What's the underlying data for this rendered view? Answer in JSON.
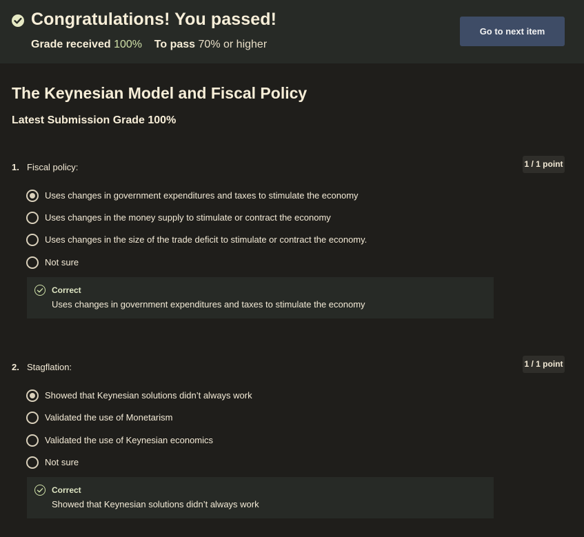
{
  "banner": {
    "title": "Congratulations! You passed!",
    "grade_received_label": "Grade received",
    "grade_received_value": "100%",
    "to_pass_label": "To pass",
    "to_pass_value": "70%",
    "to_pass_suffix": "or higher",
    "next_button_label": "Go to next item",
    "icon": "check-circle-icon",
    "colors": {
      "banner_bg": "#272a26",
      "button_bg": "#3e4c66",
      "correct_green": "#cfe0a8"
    }
  },
  "page": {
    "title": "The Keynesian Model and Fiscal Policy",
    "latest_grade": "Latest Submission Grade 100%"
  },
  "questions": [
    {
      "number": "1.",
      "text": "Fiscal policy:",
      "points": "1 / 1 point",
      "options": [
        {
          "label": "Uses changes in government expenditures and taxes to stimulate the economy",
          "selected": true
        },
        {
          "label": "Uses changes in the money supply to stimulate or contract the economy",
          "selected": false
        },
        {
          "label": "Uses changes in the size of the trade deficit to stimulate or contract the economy.",
          "selected": false
        },
        {
          "label": "Not sure",
          "selected": false
        }
      ],
      "feedback": {
        "status": "Correct",
        "text": "Uses changes in government expenditures and taxes to stimulate the economy",
        "icon": "check-circle-icon"
      }
    },
    {
      "number": "2.",
      "text": "Stagflation:",
      "points": "1 / 1 point",
      "options": [
        {
          "label": "Showed that Keynesian solutions didn’t always work",
          "selected": true
        },
        {
          "label": "Validated the use of Monetarism",
          "selected": false
        },
        {
          "label": "Validated the use of Keynesian economics",
          "selected": false
        },
        {
          "label": "Not sure",
          "selected": false
        }
      ],
      "feedback": {
        "status": "Correct",
        "text": "Showed that Keynesian solutions didn’t always work",
        "icon": "check-circle-icon"
      }
    }
  ]
}
